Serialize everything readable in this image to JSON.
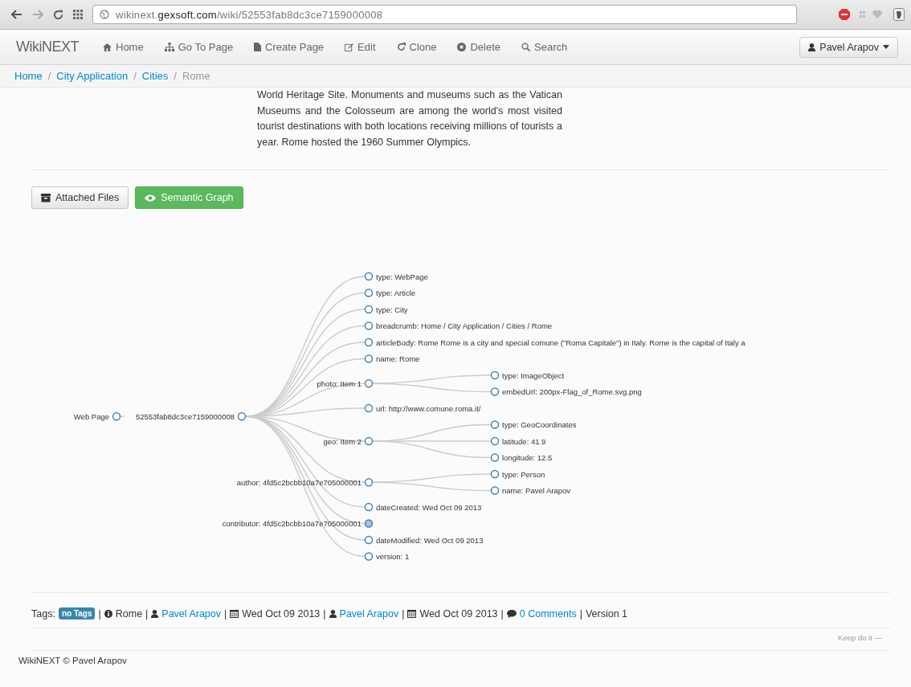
{
  "browser": {
    "url_prefix": "wikinext.",
    "url_domain": "gexsoft.com",
    "url_path": "/wiki/52553fab8dc3ce7159000008"
  },
  "navbar": {
    "brand": "WikiNEXT",
    "items": [
      {
        "kind": "home",
        "label": "Home"
      },
      {
        "kind": "sitemap",
        "label": "Go To Page"
      },
      {
        "kind": "file",
        "label": "Create Page"
      },
      {
        "kind": "edit",
        "label": "Edit"
      },
      {
        "kind": "clone",
        "label": "Clone"
      },
      {
        "kind": "delete",
        "label": "Delete"
      },
      {
        "kind": "search",
        "label": "Search"
      }
    ],
    "user": "Pavel Arapov"
  },
  "breadcrumb": {
    "separator": "/",
    "items": [
      {
        "label": "Home",
        "link": true
      },
      {
        "label": "City Application",
        "link": true
      },
      {
        "label": "Cities",
        "link": true
      },
      {
        "label": "Rome",
        "link": false
      }
    ]
  },
  "article": {
    "text": "World Heritage Site. Monuments and museums such as the Vatican Museums and the Colosseum are among the world's most visited tourist destinations with both locations receiving millions of tourists a year. Rome hosted the 1960 Summer Olympics."
  },
  "tabs": [
    {
      "kind": "files",
      "label": "Attached Files",
      "selected": false
    },
    {
      "kind": "graph",
      "label": "Semantic Graph",
      "selected": true
    }
  ],
  "graph": {
    "label": "Web Page",
    "collapsed": false,
    "children": [
      {
        "label": "52553fab8dc3ce7159000008",
        "collapsed": false,
        "children": [
          {
            "label": "type: WebPage",
            "collapsed": false
          },
          {
            "label": "type: Article",
            "collapsed": false
          },
          {
            "label": "type: City",
            "collapsed": false
          },
          {
            "label": "breadcrumb: Home / City Application / Cities / Rome",
            "collapsed": false
          },
          {
            "label": "articleBody: Rome Rome is a city and special comune (\"Roma Capitale\") in Italy. Rome is the capital of Italy a",
            "collapsed": false
          },
          {
            "label": "name: Rome",
            "collapsed": false
          },
          {
            "label": "photo: Item 1",
            "collapsed": false,
            "children": [
              {
                "label": "type: ImageObject",
                "collapsed": false
              },
              {
                "label": "embedUrl: 200px-Flag_of_Rome.svg.png",
                "collapsed": false
              }
            ]
          },
          {
            "label": "url: http://www.comune.roma.it/",
            "collapsed": false
          },
          {
            "label": "geo: Item 2",
            "collapsed": false,
            "children": [
              {
                "label": "type: GeoCoordinates",
                "collapsed": false
              },
              {
                "label": "latitude: 41.9",
                "collapsed": false
              },
              {
                "label": "longitude: 12.5",
                "collapsed": false
              }
            ]
          },
          {
            "label": "author: 4fd5c2bcbb10a7e705000001",
            "collapsed": false,
            "children": [
              {
                "label": "type: Person",
                "collapsed": false
              },
              {
                "label": "name: Pavel Arapov",
                "collapsed": false
              }
            ]
          },
          {
            "label": "dateCreated: Wed Oct 09 2013",
            "collapsed": false
          },
          {
            "label": "contributor: 4fd5c2bcbb10a7e705000001",
            "collapsed": true
          },
          {
            "label": "dateModified: Wed Oct 09 2013",
            "collapsed": false
          },
          {
            "label": "version: 1",
            "collapsed": false
          }
        ]
      }
    ]
  },
  "meta": {
    "tags_label": "Tags:",
    "tag": "no Tags",
    "separator": "|",
    "items": [
      {
        "kind": "info",
        "text": "Rome",
        "link": false
      },
      {
        "kind": "user",
        "text": "Pavel Arapov",
        "link": true
      },
      {
        "kind": "calendar",
        "text": "Wed Oct 09 2013",
        "link": false
      },
      {
        "kind": "user",
        "text": "Pavel Arapov",
        "link": true
      },
      {
        "kind": "calendar",
        "text": "Wed Oct 09 2013",
        "link": false
      },
      {
        "kind": "comment",
        "text": "0 Comments",
        "link": true
      },
      {
        "kind": "plain",
        "text": "Version 1",
        "link": false
      }
    ]
  },
  "keep_note": "Keep do it —",
  "footer": "WikiNEXT © Pavel Arapov"
}
